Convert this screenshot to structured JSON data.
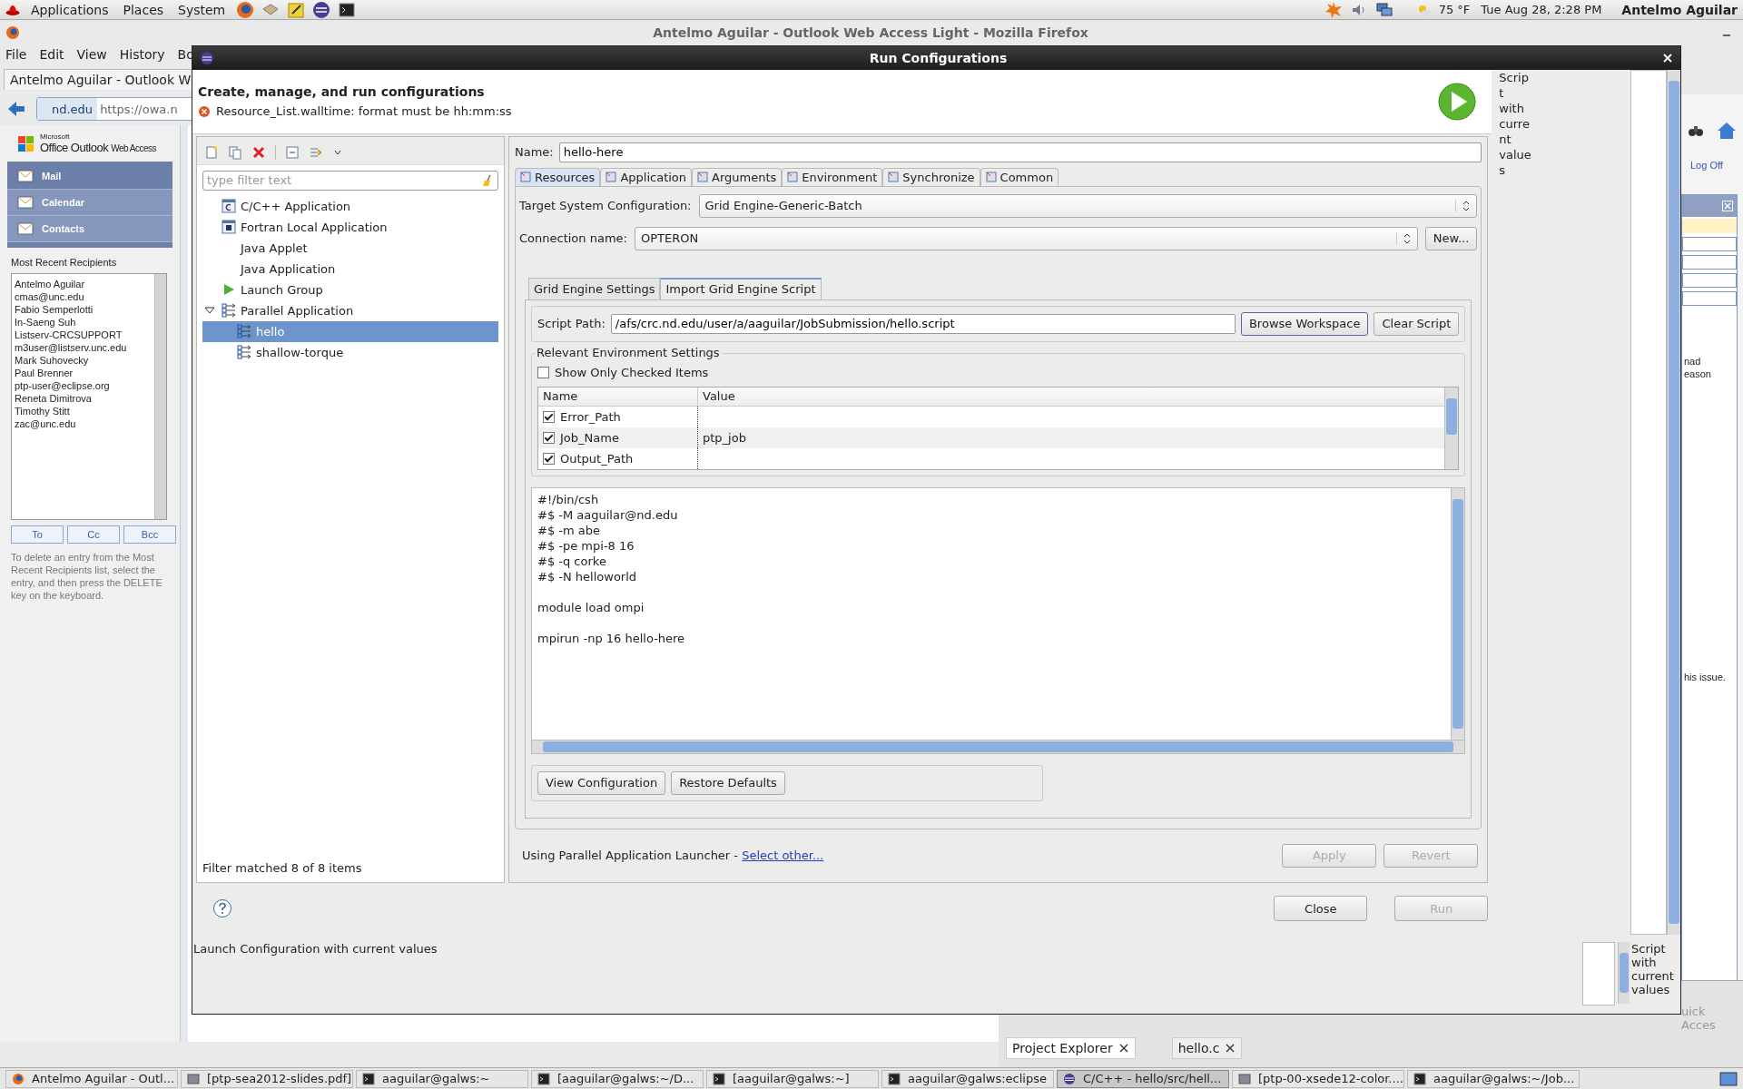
{
  "top_panel": {
    "menus": [
      "Applications",
      "Places",
      "System"
    ],
    "weather": "75 °F",
    "clock": "Tue Aug 28,  2:28 PM",
    "user": "Antelmo Aguilar"
  },
  "browser": {
    "title": "Antelmo Aguilar - Outlook Web Access Light - Mozilla Firefox",
    "menus": [
      "File",
      "Edit",
      "View",
      "History",
      "Bo"
    ],
    "tab": "Antelmo Aguilar - Outlook W",
    "url_site": "nd.edu",
    "url": "https://owa.n",
    "logo_small": "Microsoft",
    "logo_main": "Office Outlook",
    "logo_sub": "Web Access",
    "log_off": "Log Off",
    "nav": [
      {
        "label": "Mail",
        "selected": true
      },
      {
        "label": "Calendar",
        "selected": false
      },
      {
        "label": "Contacts",
        "selected": false
      }
    ],
    "recipients_title": "Most Recent Recipients",
    "recipients": [
      "Antelmo Aguilar",
      "cmas@unc.edu",
      "Fabio Semperlotti",
      "In-Saeng Suh",
      "Listserv-CRCSUPPORT",
      "m3user@listserv.unc.edu",
      "Mark Suhovecky",
      "Paul Brenner",
      "ptp-user@eclipse.org",
      "Reneta Dimitrova",
      "Timothy Stitt",
      "zac@unc.edu"
    ],
    "recipient_buttons": [
      "To",
      "Cc",
      "Bcc"
    ],
    "help": "To delete an entry from the Most Recent Recipients list, select the entry, and then press the DELETE key on the keyboard.",
    "fragments": [
      "nad",
      "eason",
      "his issue."
    ]
  },
  "dialog": {
    "title": "Run Configurations",
    "heading": "Create, manage, and run configurations",
    "error": "Resource_List.walltime: format must be hh:mm:ss",
    "side_text": "Script with current values",
    "filter_placeholder": "type filter text",
    "tree": [
      {
        "label": "C/C++ Application",
        "kind": "c",
        "selected": false
      },
      {
        "label": "Fortran Local Application",
        "kind": "f",
        "selected": false
      },
      {
        "label": "Java Applet",
        "kind": "plain",
        "selected": false
      },
      {
        "label": "Java Application",
        "kind": "plain",
        "selected": false
      },
      {
        "label": "Launch Group",
        "kind": "launch",
        "selected": false
      },
      {
        "label": "Parallel Application",
        "kind": "parallel",
        "selected": false,
        "expanded": true,
        "children": [
          {
            "label": "hello",
            "kind": "parallel",
            "selected": true
          },
          {
            "label": "shallow-torque",
            "kind": "parallel",
            "selected": false
          }
        ]
      }
    ],
    "filter_status": "Filter matched 8 of 8 items",
    "name_label": "Name:",
    "name_value": "hello-here",
    "tabs": [
      {
        "label": "Resources",
        "selected": true
      },
      {
        "label": "Application",
        "selected": false
      },
      {
        "label": "Arguments",
        "selected": false
      },
      {
        "label": "Environment",
        "selected": false
      },
      {
        "label": "Synchronize",
        "selected": false
      },
      {
        "label": "Common",
        "selected": false
      }
    ],
    "target_label": "Target System Configuration:",
    "target_value": "Grid Engine-Generic-Batch",
    "connection_label": "Connection name:",
    "connection_value": "OPTERON",
    "new_button": "New...",
    "subtabs": [
      {
        "label": "Grid Engine Settings",
        "selected": false
      },
      {
        "label": "Import Grid Engine Script",
        "selected": true
      }
    ],
    "script_path_label": "Script Path:",
    "script_path": "/afs/crc.nd.edu/user/a/aaguilar/JobSubmission/hello.script",
    "browse_button": "Browse Workspace",
    "clear_button": "Clear Script",
    "env_group": "Relevant Environment Settings",
    "show_only": {
      "label": "Show Only Checked Items",
      "checked": false
    },
    "env_columns": [
      "Name",
      "Value"
    ],
    "env_rows": [
      {
        "name": "Error_Path",
        "checked": true
      },
      {
        "name": "Job_Name",
        "value": "ptp_job",
        "checked": true
      },
      {
        "name": "Output_Path",
        "checked": true
      }
    ],
    "script": "#!/bin/csh\n#$ -M aaguilar@nd.edu\n#$ -m abe\n#$ -pe mpi-8 16\n#$ -q corke\n#$ -N helloworld\n\nmodule load ompi\n\nmpirun -np 16 hello-here",
    "view_button": "View Configuration",
    "restore_button": "Restore Defaults",
    "launcher_text": "Using Parallel Application Launcher - ",
    "launcher_link": "Select other...",
    "apply": {
      "label": "Apply",
      "disabled": true
    },
    "revert": {
      "label": "Revert",
      "disabled": true
    },
    "close": {
      "label": "Close",
      "disabled": false
    },
    "run": {
      "label": "Run",
      "disabled": true
    },
    "status": "Launch Configuration with current values",
    "corner_text": "Script with current values"
  },
  "eclipse": {
    "tabs": [
      {
        "label": "Project Explorer",
        "selected": true
      },
      {
        "label": "hello.c",
        "selected": false
      }
    ],
    "quick_access": "uick Acces"
  },
  "taskbar": [
    {
      "label": "Antelmo Aguilar - Outl...",
      "kind": "browser",
      "selected": false
    },
    {
      "label": "[ptp-sea2012-slides.pdf]",
      "kind": "document",
      "selected": false
    },
    {
      "label": "aaguilar@galws:~",
      "kind": "terminal",
      "selected": false
    },
    {
      "label": "[aaguilar@galws:~/D...",
      "kind": "terminal",
      "selected": false
    },
    {
      "label": "[aaguilar@galws:~]",
      "kind": "terminal",
      "selected": false
    },
    {
      "label": "aaguilar@galws:eclipse",
      "kind": "terminal",
      "selected": false
    },
    {
      "label": "C/C++ - hello/src/hell...",
      "kind": "ide",
      "selected": true
    },
    {
      "label": "[ptp-00-xsede12-color....",
      "kind": "document",
      "selected": false
    },
    {
      "label": "aaguilar@galws:~/Job...",
      "kind": "terminal",
      "selected": false
    }
  ]
}
